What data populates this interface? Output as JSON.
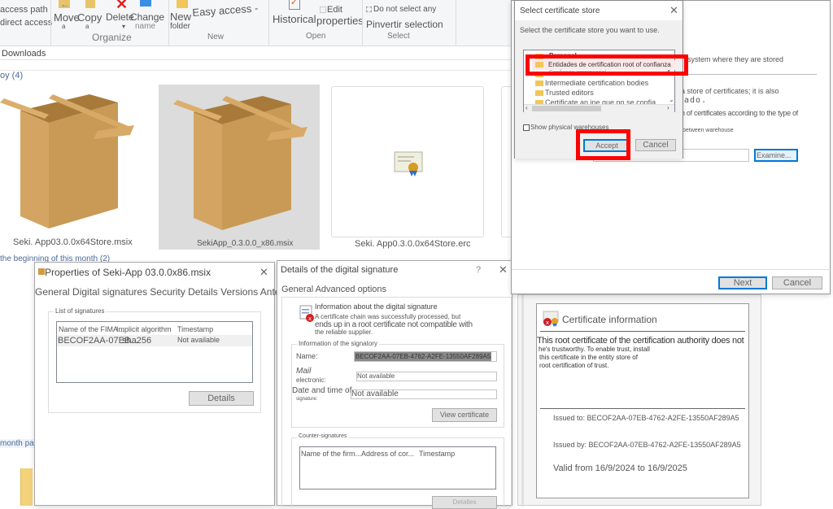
{
  "ribbon": {
    "left_items": [
      "access path",
      "direct access"
    ],
    "organize": {
      "move_label": "Move",
      "move_sub": "a",
      "copy_label": "Copy",
      "copy_sub": "a",
      "delete_label": "Delete",
      "rename_label": "Change",
      "rename_sub": "name",
      "group_label": "Organize"
    },
    "new": {
      "new_folder_label": "New",
      "new_folder_sub": "folder",
      "easy_access_label": "Easy access -",
      "group_label": "New"
    },
    "open": {
      "historical_label": "Historical",
      "edit_label": "Edit",
      "properties_label": "properties",
      "group_label": "Open"
    },
    "select": {
      "select_none_label": "Do not select any",
      "invert_label": "Pinvertir selection",
      "group_label": "Select"
    }
  },
  "address_bar": {
    "path": "Downloads"
  },
  "explorer": {
    "group1_header": "oy (4)",
    "group2_header": "the beginning of this month (2)",
    "group3_header": "month pa",
    "files": [
      {
        "name": "Seki. App03.0.0x64Store.msix",
        "icon": "package-box-icon",
        "selected": false
      },
      {
        "name": "SekiApp_0.3.0.0_x86.msix",
        "icon": "package-box-icon",
        "selected": true
      },
      {
        "name": "Seki. App0.3.0.0x64Store.erc",
        "icon": "certificate-icon",
        "selected": false
      }
    ]
  },
  "properties_dialog": {
    "title": "Properties of Seki-App 03.0.0x86.msix",
    "tabs": "General Digital signatures Security Details Versions Antennas",
    "list_legend": "List of signatures",
    "columns": [
      "Name of the FIMA...",
      "Implicit algorithm",
      "Timestamp"
    ],
    "rows": [
      {
        "name": "BECOF2AA-07EB...",
        "algorithm": "sha256",
        "timestamp": "Not available"
      }
    ],
    "details_button": "Details"
  },
  "signature_details_dialog": {
    "title": "Details of the digital signature",
    "help": "?",
    "tabs": "General Advanced options",
    "info_title": "Information about the digital signature",
    "info_line1": "A certificate chain was successfully processed, but",
    "info_line2": "ends up in a root certificate not compatible with",
    "info_line3": "the reliable supplier.",
    "signer_legend": "Information of the signatory",
    "name_label": "Name:",
    "name_value": "BECOF2AA-07EB-4762-A2FE-13550AF289A5",
    "mail_label1": "Mail",
    "mail_label2": "electronic:",
    "mail_value": "Not available",
    "date_label1": "Date and time of",
    "date_label2": "signature:",
    "date_value": "Not available",
    "view_cert_button": "View certificate",
    "counter_legend": "Counter-signatures",
    "counter_columns": [
      "Name of the firm...",
      "Address of cor...",
      "Timestamp"
    ],
    "counter_details_button": "Detalles"
  },
  "certificate_dialog": {
    "header": "Certificate information",
    "warning_line1": "This root certificate of the certification authority does not",
    "warning_line2": "he's trustworthy. To enable trust, install",
    "warning_line3": "this certificate in the entity store of",
    "warning_line4": "root certification of trust.",
    "issued_to": "Issued to: BECOF2AA-07EB-4762-A2FE-13550AF289A5",
    "issued_by": "Issued by: BECOF2AA-07EB-4762-A2FE-13550AF289A5",
    "valid": "Valid from 16/9/2024 to 16/9/2025"
  },
  "import_wizard": {
    "text1": "system where they are stored",
    "text2": "a store of certificates; it is also",
    "text3": "cado.",
    "text4": "n of certificates according to the type of",
    "text5": "between warehouse",
    "examine_button": "Examine...",
    "next_button": "Next",
    "cancel_button": "Cancel"
  },
  "store_dialog": {
    "title": "Select certificate store",
    "prompt": "Select the certificate store you want to use.",
    "stores": [
      "Personal",
      "Entidades de certification root of confianza",
      "Confianza empresarial",
      "Intermediate certification bodies",
      "Trusted editors",
      "Certificate an ine que no se confia"
    ],
    "selected_index": 1,
    "show_physical_label": "Show physical warehouses",
    "show_physical_checked": false,
    "accept_button": "Accept",
    "cancel_button": "Cancel"
  },
  "colors": {
    "highlight": "#ff0000",
    "accent": "#0078d7"
  }
}
